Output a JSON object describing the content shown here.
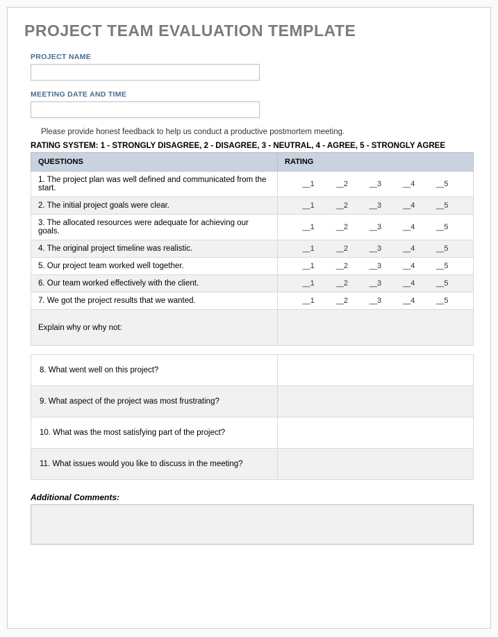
{
  "title": "PROJECT TEAM EVALUATION TEMPLATE",
  "fields": {
    "project_name_label": "PROJECT NAME",
    "meeting_date_label": "MEETING DATE AND TIME"
  },
  "intro": "Please provide honest feedback to help us conduct a productive postmortem meeting.",
  "rating_legend": "RATING SYSTEM: 1 - STRONGLY DISAGREE, 2 - DISAGREE, 3 - NEUTRAL, 4 - AGREE, 5 - STRONGLY AGREE",
  "headers": {
    "questions": "QUESTIONS",
    "rating": "RATING"
  },
  "rating_scale": [
    "1",
    "2",
    "3",
    "4",
    "5"
  ],
  "rating_questions": [
    "1. The project plan was well defined and communicated from the start.",
    "2. The initial project goals were clear.",
    "3. The allocated resources were adequate for achieving our goals.",
    "4. The original project timeline was realistic.",
    "5. Our project team worked well together.",
    "6. Our team worked effectively with the client.",
    "7. We got the project results that we wanted."
  ],
  "explain_label": "Explain why or why not:",
  "open_questions": [
    "8. What went well on this project?",
    "9. What aspect of the project was most frustrating?",
    "10. What was the most satisfying part of the project?",
    "11. What issues would you like to discuss in the meeting?"
  ],
  "additional_label": "Additional Comments:"
}
